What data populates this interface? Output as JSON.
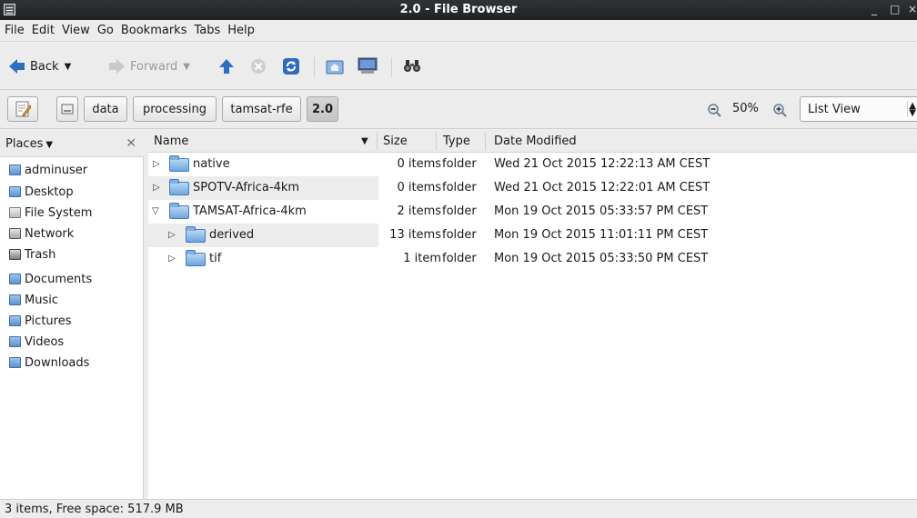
{
  "window": {
    "title": "2.0 - File Browser",
    "minimize": "_",
    "maximize": "□",
    "close": "×"
  },
  "menu": [
    "File",
    "Edit",
    "View",
    "Go",
    "Bookmarks",
    "Tabs",
    "Help"
  ],
  "toolbar": {
    "back_label": "Back",
    "forward_label": "Forward"
  },
  "location": {
    "crumbs": [
      "data",
      "processing",
      "tamsat-rfe",
      "2.0"
    ],
    "zoom": "50%",
    "view_mode": "List View"
  },
  "sidebar": {
    "header": "Places",
    "items": [
      {
        "label": "adminuser",
        "icon": "home-folder-icon"
      },
      {
        "label": "Desktop",
        "icon": "desktop-folder-icon"
      },
      {
        "label": "File System",
        "icon": "drive-icon"
      },
      {
        "label": "Network",
        "icon": "network-icon"
      },
      {
        "label": "Trash",
        "icon": "trash-icon"
      },
      {
        "label": "Documents",
        "icon": "documents-folder-icon"
      },
      {
        "label": "Music",
        "icon": "music-folder-icon"
      },
      {
        "label": "Pictures",
        "icon": "pictures-folder-icon"
      },
      {
        "label": "Videos",
        "icon": "videos-folder-icon"
      },
      {
        "label": "Downloads",
        "icon": "downloads-folder-icon"
      }
    ]
  },
  "columns": {
    "name": "Name",
    "size": "Size",
    "type": "Type",
    "date": "Date Modified"
  },
  "files": [
    {
      "name": "native",
      "size": "0 items",
      "type": "folder",
      "date": "Wed 21 Oct 2015 12:22:13 AM CEST",
      "expander": "▷"
    },
    {
      "name": "SPOTV-Africa-4km",
      "size": "0 items",
      "type": "folder",
      "date": "Wed 21 Oct 2015 12:22:01 AM CEST",
      "expander": "▷"
    },
    {
      "name": "TAMSAT-Africa-4km",
      "size": "2 items",
      "type": "folder",
      "date": "Mon 19 Oct 2015 05:33:57 PM CEST",
      "expander": "▽"
    },
    {
      "name": "derived",
      "size": "13 items",
      "type": "folder",
      "date": "Mon 19 Oct 2015 11:01:11 PM CEST",
      "expander": "▷"
    },
    {
      "name": "tif",
      "size": "1 item",
      "type": "folder",
      "date": "Mon 19 Oct 2015 05:33:50 PM CEST",
      "expander": "▷"
    }
  ],
  "status": "3 items, Free space: 517.9 MB"
}
